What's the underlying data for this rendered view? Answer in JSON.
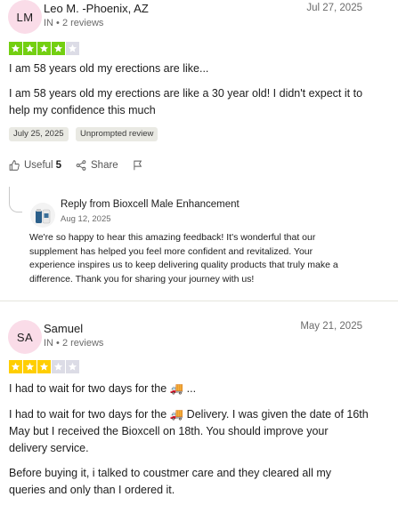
{
  "reviews": [
    {
      "initials": "LM",
      "avatar_color": "#fadce8",
      "name": "Leo M. -Phoenix, AZ",
      "meta": "IN • 2 reviews",
      "date": "Jul 27, 2025",
      "rating": 4,
      "star_color": "#73cf11",
      "title": "I am 58 years old my erections are like...",
      "body": "I am 58 years old my erections are like a 30 year old! I didn't expect it to help my confidence this much",
      "tags": [
        "July 25, 2025",
        "Unprompted review"
      ],
      "useful_label": "Useful",
      "useful_count": "5",
      "share_label": "Share",
      "reply": {
        "from": "Reply from Bioxcell Male Enhancement",
        "date": "Aug 12, 2025",
        "text": "We're so happy to hear this amazing feedback! It's wonderful that our supplement has helped you feel more confident and revitalized. Your experience inspires us to keep delivering quality products that truly make a difference. Thank you for sharing your journey with us!"
      }
    },
    {
      "initials": "SA",
      "avatar_color": "#fadce8",
      "name": "Samuel",
      "meta": "IN • 2 reviews",
      "date": "May 21, 2025",
      "rating": 3,
      "star_color": "#ffce00",
      "title": "I had to wait for two days for the 🚚 ...",
      "body1": "I had to wait for two days for the 🚚 Delivery. I was given the date of 16th May but I received the Bioxcell on 18th. You should improve your delivery service.",
      "body2": "Before buying it, i talked to coustmer care and they cleared all my queries and only than I ordered it."
    }
  ],
  "empty_star_color": "#dcdce6"
}
